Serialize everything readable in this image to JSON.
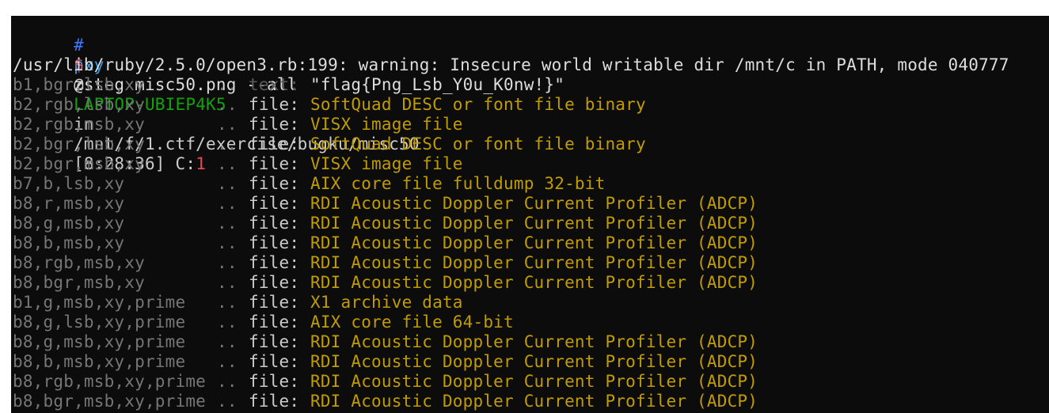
{
  "prompt": {
    "hash": "#",
    "user": "pxy",
    "at": "@",
    "host": "LAPTOP-UBIEP4K5",
    "in": "in",
    "cwd": "/mnt/f/1.ctf/exercise/bugku/misc50",
    "time": "[8:28:36]",
    "exit_label": "C:",
    "exit_code": "1"
  },
  "command": {
    "sigil": "$",
    "text": "zsteg misc50.png --all"
  },
  "warning": "/usr/lib/ruby/2.5.0/open3.rb:199: warning: Insecure world writable dir /mnt/c in PATH, mode 040777",
  "results": [
    {
      "cfg": "b1,bgr,lsb,xy",
      "sep": "..",
      "kind": "text:",
      "value": "\"flag{Png_Lsb_Y0u_K0nw!}\""
    },
    {
      "cfg": "b2,rgb,lsb,xy",
      "sep": "..",
      "kind": "file:",
      "value": "SoftQuad DESC or font file binary"
    },
    {
      "cfg": "b2,rgb,msb,xy",
      "sep": "..",
      "kind": "file:",
      "value": "VISX image file"
    },
    {
      "cfg": "b2,bgr,lsb,xy",
      "sep": "..",
      "kind": "file:",
      "value": "SoftQuad DESC or font file binary"
    },
    {
      "cfg": "b2,bgr,msb,xy",
      "sep": "..",
      "kind": "file:",
      "value": "VISX image file"
    },
    {
      "cfg": "b7,b,lsb,xy",
      "sep": "..",
      "kind": "file:",
      "value": "AIX core file fulldump 32-bit"
    },
    {
      "cfg": "b8,r,msb,xy",
      "sep": "..",
      "kind": "file:",
      "value": "RDI Acoustic Doppler Current Profiler (ADCP)"
    },
    {
      "cfg": "b8,g,msb,xy",
      "sep": "..",
      "kind": "file:",
      "value": "RDI Acoustic Doppler Current Profiler (ADCP)"
    },
    {
      "cfg": "b8,b,msb,xy",
      "sep": "..",
      "kind": "file:",
      "value": "RDI Acoustic Doppler Current Profiler (ADCP)"
    },
    {
      "cfg": "b8,rgb,msb,xy",
      "sep": "..",
      "kind": "file:",
      "value": "RDI Acoustic Doppler Current Profiler (ADCP)"
    },
    {
      "cfg": "b8,bgr,msb,xy",
      "sep": "..",
      "kind": "file:",
      "value": "RDI Acoustic Doppler Current Profiler (ADCP)"
    },
    {
      "cfg": "b1,g,msb,xy,prime",
      "sep": "..",
      "kind": "file:",
      "value": "X1 archive data"
    },
    {
      "cfg": "b8,g,lsb,xy,prime",
      "sep": "..",
      "kind": "file:",
      "value": "AIX core file 64-bit"
    },
    {
      "cfg": "b8,g,msb,xy,prime",
      "sep": "..",
      "kind": "file:",
      "value": "RDI Acoustic Doppler Current Profiler (ADCP)"
    },
    {
      "cfg": "b8,b,msb,xy,prime",
      "sep": "..",
      "kind": "file:",
      "value": "RDI Acoustic Doppler Current Profiler (ADCP)"
    },
    {
      "cfg": "b8,rgb,msb,xy,prime",
      "sep": "..",
      "kind": "file:",
      "value": "RDI Acoustic Doppler Current Profiler (ADCP)"
    },
    {
      "cfg": "b8,bgr,msb,xy,prime",
      "sep": "..",
      "kind": "file:",
      "value": "RDI Acoustic Doppler Current Profiler (ADCP)"
    }
  ],
  "colors": {
    "background": "#0c0c0c",
    "prompt_hash": "#3b78ff",
    "host": "#13a10e",
    "exit_code": "#e74856",
    "result_value": "#c19c00",
    "config_dim": "#767676"
  }
}
